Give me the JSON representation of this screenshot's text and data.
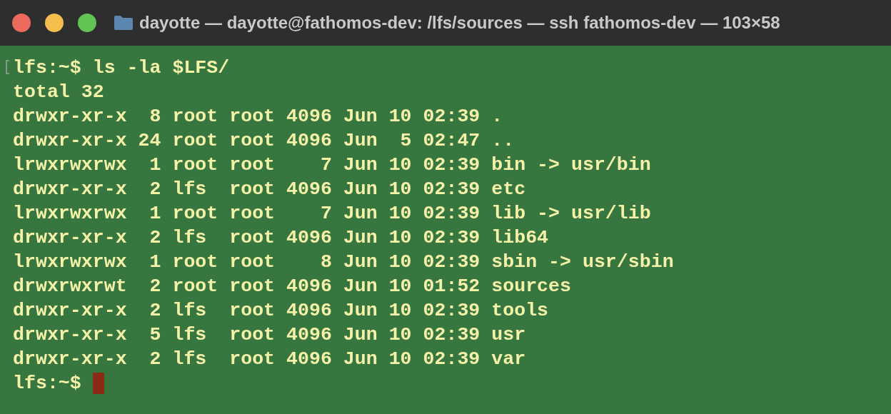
{
  "window": {
    "title": "dayotte — dayotte@fathomos-dev: /lfs/sources — ssh fathomos-dev — 103×58"
  },
  "terminal": {
    "lines": [
      {
        "text": "lfs:~$ ls -la $LFS/",
        "cursor": false
      },
      {
        "text": "total 32",
        "cursor": false
      },
      {
        "text": "drwxr-xr-x  8 root root 4096 Jun 10 02:39 .",
        "cursor": false
      },
      {
        "text": "drwxr-xr-x 24 root root 4096 Jun  5 02:47 ..",
        "cursor": false
      },
      {
        "text": "lrwxrwxrwx  1 root root    7 Jun 10 02:39 bin -> usr/bin",
        "cursor": false
      },
      {
        "text": "drwxr-xr-x  2 lfs  root 4096 Jun 10 02:39 etc",
        "cursor": false
      },
      {
        "text": "lrwxrwxrwx  1 root root    7 Jun 10 02:39 lib -> usr/lib",
        "cursor": false
      },
      {
        "text": "drwxr-xr-x  2 lfs  root 4096 Jun 10 02:39 lib64",
        "cursor": false
      },
      {
        "text": "lrwxrwxrwx  1 root root    8 Jun 10 02:39 sbin -> usr/sbin",
        "cursor": false
      },
      {
        "text": "drwxrwxrwt  2 root root 4096 Jun 10 01:52 sources",
        "cursor": false
      },
      {
        "text": "drwxr-xr-x  2 lfs  root 4096 Jun 10 02:39 tools",
        "cursor": false
      },
      {
        "text": "drwxr-xr-x  5 lfs  root 4096 Jun 10 02:39 usr",
        "cursor": false
      },
      {
        "text": "drwxr-xr-x  2 lfs  root 4096 Jun 10 02:39 var",
        "cursor": false
      },
      {
        "text": "lfs:~$",
        "cursor": true
      }
    ]
  }
}
